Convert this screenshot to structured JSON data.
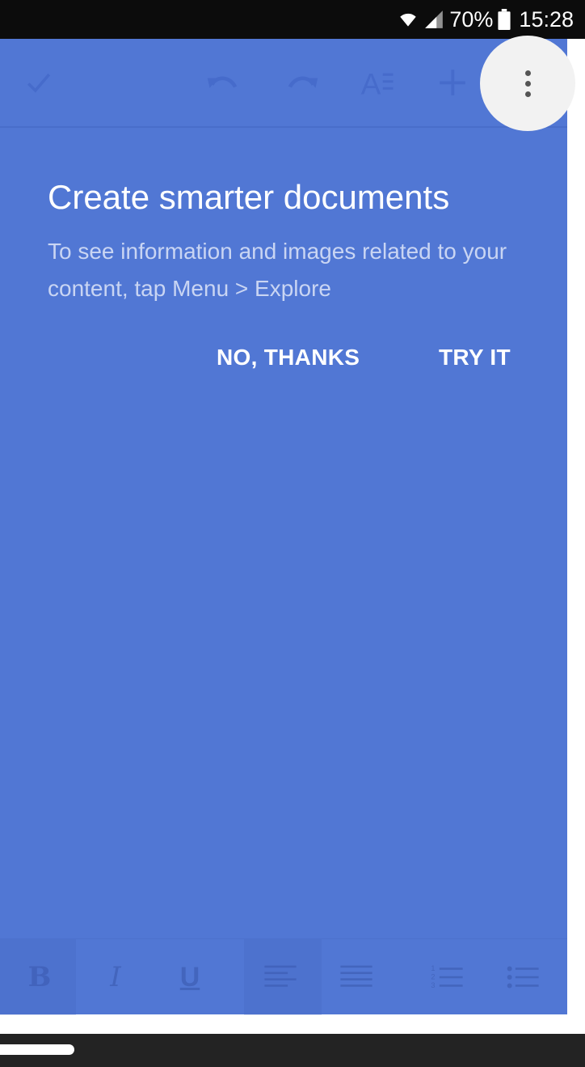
{
  "status_bar": {
    "battery_text": "70%",
    "time": "15:28",
    "icons": [
      "wifi-icon",
      "signal-icon",
      "battery-icon"
    ]
  },
  "toolbar": {
    "icons": [
      "check-icon",
      "undo-icon",
      "redo-icon",
      "text-format-icon",
      "add-icon",
      "more-vert-icon"
    ]
  },
  "tip": {
    "title": "Create smarter documents",
    "body": "To see information and images related to your content, tap Menu > Explore",
    "no_label": "NO, THANKS",
    "try_label": "TRY IT"
  },
  "format_bar": {
    "bold": "B",
    "italic": "I",
    "underline": "U",
    "icons": [
      "align-left-icon",
      "align-justify-icon",
      "numbered-list-icon",
      "bulleted-list-icon"
    ]
  },
  "colors": {
    "overlay": "#5177d4",
    "status_bar": "#0c0c0c",
    "nav_bar": "#232323",
    "text_primary": "#ffffff",
    "text_secondary": "#c9d5f3"
  }
}
